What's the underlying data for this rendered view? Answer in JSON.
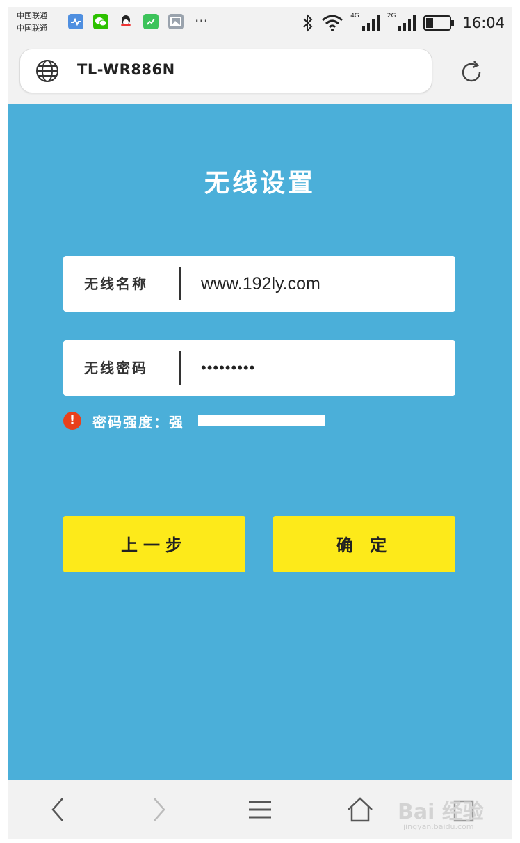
{
  "status_bar": {
    "carrier_line1": "中国联通",
    "carrier_line2": "中国联通",
    "more": "···",
    "net1_label": "4G",
    "net2_label": "2G",
    "time": "16:04",
    "battery_level": 0.3,
    "icons": [
      "health-app-icon",
      "wechat-icon",
      "qq-icon",
      "phone-green-icon",
      "gallery-icon",
      "bluetooth-icon",
      "wifi-icon",
      "signal-icon",
      "battery-icon"
    ]
  },
  "browser": {
    "url": "TL-WR886N",
    "icons": [
      "globe-icon",
      "refresh-icon"
    ]
  },
  "page": {
    "title": "无线设置",
    "ssid_label": "无线名称",
    "ssid_value": "www.192ly.com",
    "password_label": "无线密码",
    "password_value": "•••••••••",
    "strength_label": "密码强度：强",
    "strength_level": 1.0,
    "back_button": "上一步",
    "confirm_button": "确 定"
  },
  "bottom_nav": {
    "icons": [
      "back-arrow-icon",
      "forward-arrow-icon",
      "menu-icon",
      "home-icon",
      "tabs-icon"
    ]
  },
  "watermark": {
    "main": "Bai 经验",
    "sub": "jingyan.baidu.com"
  },
  "colors": {
    "page_bg": "#4bafd9",
    "button_bg": "#fdea1a",
    "warning": "#e8401c",
    "chrome_bg": "#f2f2f2"
  }
}
